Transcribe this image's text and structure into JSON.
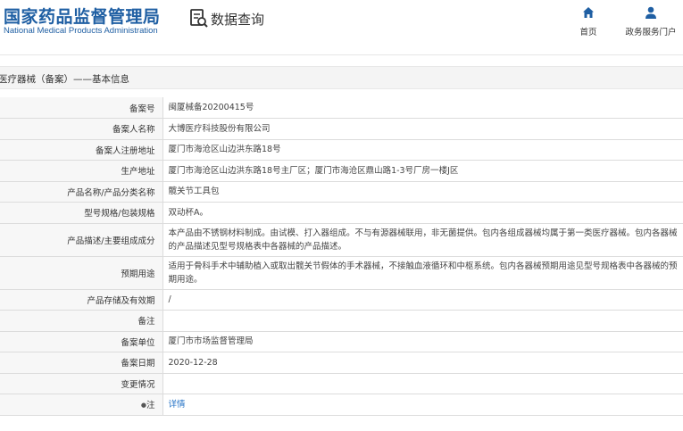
{
  "header": {
    "logo_cn": "国家药品监督管理局",
    "logo_en": "National Medical Products Administration",
    "query_label": "数据查询",
    "nav": [
      {
        "label": "首页",
        "icon": "home-icon"
      },
      {
        "label": "政务服务门户",
        "icon": "user-icon"
      }
    ]
  },
  "section": {
    "title": "医疗器械（备案）——基本信息"
  },
  "rows": [
    {
      "label": "备案号",
      "value": "闽厦械备20200415号"
    },
    {
      "label": "备案人名称",
      "value": "大博医疗科技股份有限公司"
    },
    {
      "label": "备案人注册地址",
      "value": "厦门市海沧区山边洪东路18号"
    },
    {
      "label": "生产地址",
      "value": "厦门市海沧区山边洪东路18号主厂区；厦门市海沧区鼎山路1-3号厂房一楼J区"
    },
    {
      "label": "产品名称/产品分类名称",
      "value": "髋关节工具包"
    },
    {
      "label": "型号规格/包装规格",
      "value": "双动杯A。"
    },
    {
      "label": "产品描述/主要组成成分",
      "value": "本产品由不锈钢材料制成。由试模、打入器组成。不与有源器械联用，非无菌提供。包内各组成器械均属于第一类医疗器械。包内各器械的产品描述见型号规格表中各器械的产品描述。"
    },
    {
      "label": "预期用途",
      "value": "适用于骨科手术中辅助植入或取出髋关节假体的手术器械，不接触血液循环和中枢系统。包内各器械预期用途见型号规格表中各器械的预期用途。"
    },
    {
      "label": "产品存储及有效期",
      "value": "/"
    },
    {
      "label": "备注",
      "value": ""
    },
    {
      "label": "备案单位",
      "value": "厦门市市场监督管理局"
    },
    {
      "label": "备案日期",
      "value": "2020-12-28"
    },
    {
      "label": "变更情况",
      "value": ""
    },
    {
      "label": "注",
      "value": "详情"
    }
  ],
  "colors": {
    "brand": "#1f5fa3",
    "link": "#1f6fc4",
    "label_bg": "#f7f7f7",
    "band_bg": "#f4f4f4"
  }
}
